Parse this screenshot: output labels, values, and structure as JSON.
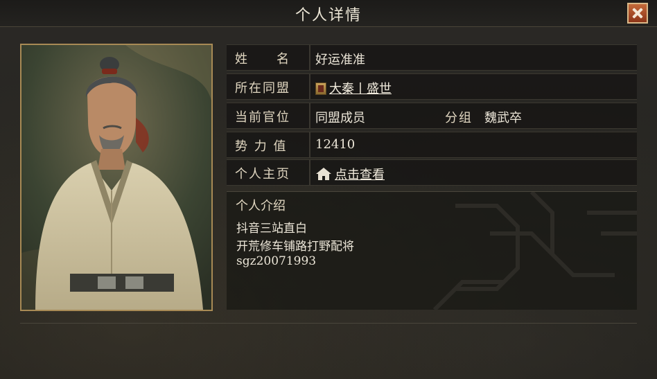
{
  "header": {
    "title": "个人详情"
  },
  "profile": {
    "name_label": "姓　　名",
    "name": "好运准准",
    "alliance_label": "所在同盟",
    "alliance": "大秦丨盛世",
    "position_label": "当前官位",
    "position": "同盟成员",
    "group_label": "分组",
    "group": "魏武卒",
    "power_label": "势 力 值",
    "power": "12410",
    "homepage_label": "个人主页",
    "homepage_link": "点击查看"
  },
  "intro": {
    "title": "个人介绍",
    "lines": [
      "抖音三站直白",
      "开荒修车铺路打野配将",
      "sgz20071993"
    ]
  },
  "icons": {
    "close": "close-icon",
    "alliance": "alliance-flag-icon",
    "home": "home-icon"
  },
  "colors": {
    "accent_close": "#b04a22",
    "frame_gold": "#a88a55"
  }
}
